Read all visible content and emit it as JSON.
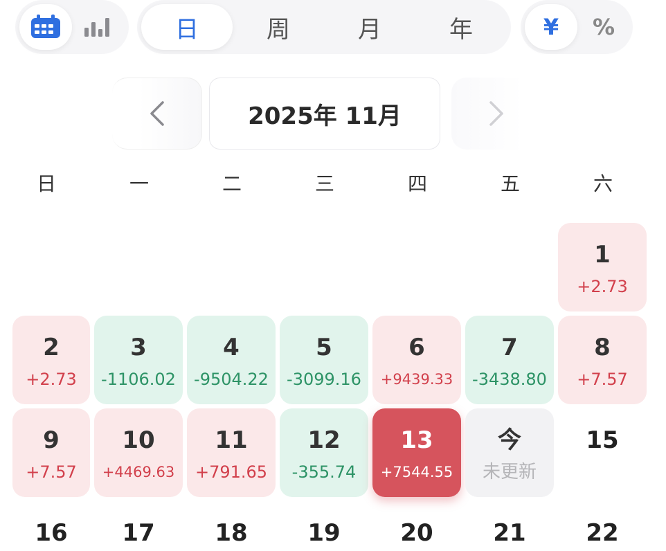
{
  "toolbar": {
    "view": {
      "calendar_icon": "calendar-icon",
      "chart_icon": "bar-chart-icon"
    },
    "periods": [
      "日",
      "周",
      "月",
      "年"
    ],
    "active_period": "日",
    "units": {
      "yuan": "¥",
      "percent": "%"
    }
  },
  "month_nav": {
    "title": "2025年 11月",
    "prev_icon": "chevron-left-icon",
    "next_icon": "chevron-right-icon"
  },
  "weekdays": [
    "日",
    "一",
    "二",
    "三",
    "四",
    "五",
    "六"
  ],
  "colors": {
    "accent": "#2f6fe0",
    "profit": "#d2404c",
    "loss": "#2d9366",
    "selected": "#d6545d"
  },
  "days": [
    {
      "day": "1",
      "pnl": "+2.73",
      "type": "pos"
    },
    {
      "day": "2",
      "pnl": "+2.73",
      "type": "pos"
    },
    {
      "day": "3",
      "pnl": "-1106.02",
      "type": "neg"
    },
    {
      "day": "4",
      "pnl": "-9504.22",
      "type": "neg"
    },
    {
      "day": "5",
      "pnl": "-3099.16",
      "type": "neg"
    },
    {
      "day": "6",
      "pnl": "+9439.33",
      "type": "pos"
    },
    {
      "day": "7",
      "pnl": "-3438.80",
      "type": "neg"
    },
    {
      "day": "8",
      "pnl": "+7.57",
      "type": "pos"
    },
    {
      "day": "9",
      "pnl": "+7.57",
      "type": "pos"
    },
    {
      "day": "10",
      "pnl": "+4469.63",
      "type": "pos"
    },
    {
      "day": "11",
      "pnl": "+791.65",
      "type": "pos"
    },
    {
      "day": "12",
      "pnl": "-355.74",
      "type": "neg"
    },
    {
      "day": "13",
      "pnl": "+7544.55",
      "type": "sel"
    },
    {
      "day": "今",
      "pnl": "未更新",
      "type": "today"
    },
    {
      "day": "15",
      "pnl": "",
      "type": "plain"
    },
    {
      "day": "16",
      "pnl": "",
      "type": "plain"
    },
    {
      "day": "17",
      "pnl": "",
      "type": "plain"
    },
    {
      "day": "18",
      "pnl": "",
      "type": "plain"
    },
    {
      "day": "19",
      "pnl": "",
      "type": "plain"
    },
    {
      "day": "20",
      "pnl": "",
      "type": "plain"
    },
    {
      "day": "21",
      "pnl": "",
      "type": "plain"
    },
    {
      "day": "22",
      "pnl": "",
      "type": "plain"
    }
  ]
}
